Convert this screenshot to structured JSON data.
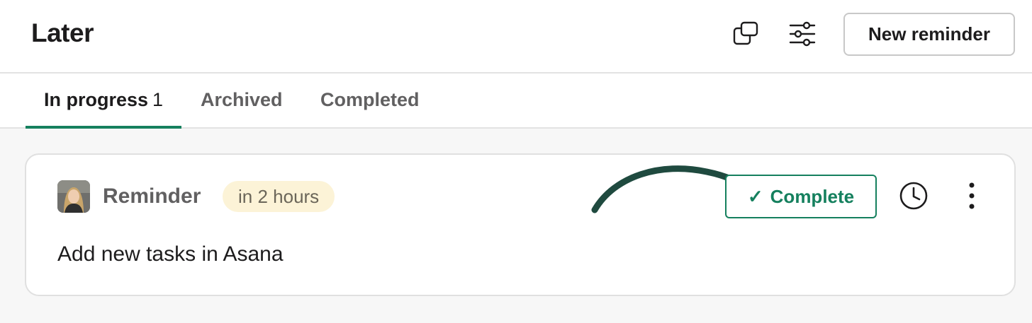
{
  "header": {
    "title": "Later",
    "copy_icon": "copy-window-icon",
    "filter_icon": "filter-sliders-icon",
    "new_reminder_label": "New reminder"
  },
  "tabs": [
    {
      "label": "In progress",
      "count": "1",
      "active": true
    },
    {
      "label": "Archived",
      "active": false
    },
    {
      "label": "Completed",
      "active": false
    }
  ],
  "reminder": {
    "label": "Reminder",
    "due_badge": "in 2 hours",
    "complete_label": "Complete",
    "text": "Add new tasks in Asana",
    "avatar_icon": "user-avatar",
    "annotation_icon": "curved-arrow-icon",
    "clock_icon": "clock-icon",
    "more_icon": "more-vertical-icon"
  },
  "colors": {
    "accent": "#15805e",
    "badge_bg": "#fcf3d7",
    "arrow": "#1f4a3f",
    "background": "#f7f7f7"
  }
}
